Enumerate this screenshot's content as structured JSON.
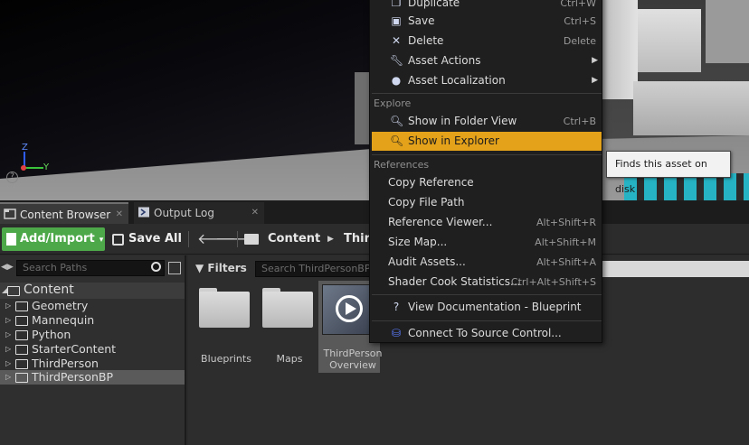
{
  "viewport": {
    "axis_z": "Z",
    "axis_y": "Y",
    "help_icon": "?"
  },
  "tabs": [
    {
      "label": "Content Browser",
      "icon": "content-browser-icon"
    },
    {
      "label": "Output Log",
      "icon": "output-log-icon"
    }
  ],
  "toolbar": {
    "add_import": "Add/Import",
    "save_all": "Save All",
    "breadcrumbs": [
      "Content",
      "Third"
    ]
  },
  "left_panel": {
    "search_placeholder": "Search Paths",
    "tree": [
      {
        "label": "Content",
        "root": true
      },
      {
        "label": "Geometry"
      },
      {
        "label": "Mannequin"
      },
      {
        "label": "Python"
      },
      {
        "label": "StarterContent"
      },
      {
        "label": "ThirdPerson"
      },
      {
        "label": "ThirdPersonBP",
        "selected": true
      }
    ]
  },
  "right_panel": {
    "filters_label": "Filters",
    "search_placeholder": "Search ThirdPersonBP",
    "tiles": [
      {
        "label": "Blueprints",
        "type": "folder"
      },
      {
        "label": "Maps",
        "type": "folder"
      },
      {
        "label_line1": "ThirdPerson",
        "label_line2": "Overview",
        "type": "blueprint"
      }
    ]
  },
  "context_menu": {
    "items_top": [
      {
        "label": "Duplicate",
        "shortcut": "Ctrl+W",
        "icon": "duplicate-icon"
      },
      {
        "label": "Save",
        "shortcut": "Ctrl+S",
        "icon": "save-icon"
      },
      {
        "label": "Delete",
        "shortcut": "Delete",
        "icon": "delete-icon"
      },
      {
        "label": "Asset Actions",
        "submenu": true,
        "icon": "wrench-icon"
      },
      {
        "label": "Asset Localization",
        "submenu": true,
        "icon": "globe-icon"
      }
    ],
    "section_explore": "Explore",
    "items_explore": [
      {
        "label": "Show in Folder View",
        "shortcut": "Ctrl+B",
        "icon": "folder-search-icon"
      },
      {
        "label": "Show in Explorer",
        "highlight": true,
        "icon": "explorer-icon"
      }
    ],
    "section_references": "References",
    "items_references": [
      {
        "label": "Copy Reference"
      },
      {
        "label": "Copy File Path"
      },
      {
        "label": "Reference Viewer...",
        "shortcut": "Alt+Shift+R"
      },
      {
        "label": "Size Map...",
        "shortcut": "Alt+Shift+M"
      },
      {
        "label": "Audit Assets...",
        "shortcut": "Alt+Shift+A"
      },
      {
        "label": "Shader Cook Statistics...",
        "shortcut": "Ctrl+Alt+Shift+S"
      }
    ],
    "item_documentation": {
      "label": "View Documentation - Blueprint",
      "icon": "help-circle-icon"
    },
    "item_source_control": {
      "label": "Connect To Source Control...",
      "icon": "source-control-icon"
    }
  },
  "tooltip": "Finds this asset on disk",
  "colors": {
    "highlight": "#e3a21a",
    "add_button": "#4da84a"
  }
}
